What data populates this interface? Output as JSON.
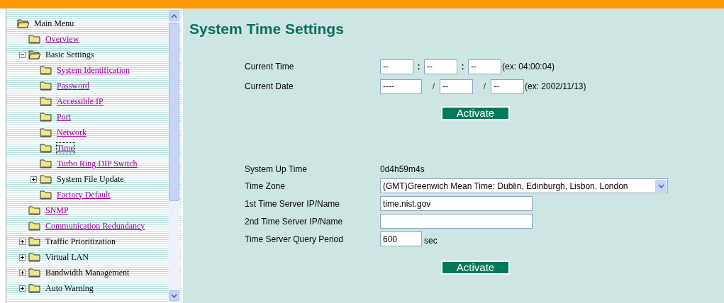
{
  "menu": {
    "label": "Main Menu",
    "kind": "root",
    "selected": false,
    "expanded": true,
    "children": [
      {
        "label": "Overview",
        "kind": "link",
        "selected": false
      },
      {
        "label": "Basic Settings",
        "kind": "group",
        "selected": false,
        "expanded": true,
        "children": [
          {
            "label": "System Identification",
            "kind": "link",
            "selected": false
          },
          {
            "label": "Password",
            "kind": "link",
            "selected": false
          },
          {
            "label": "Accessible IP",
            "kind": "link",
            "selected": false
          },
          {
            "label": "Port",
            "kind": "link",
            "selected": false
          },
          {
            "label": "Network",
            "kind": "link",
            "selected": false
          },
          {
            "label": "Time",
            "kind": "link",
            "selected": true
          },
          {
            "label": "Turbo Ring DIP Switch",
            "kind": "link",
            "selected": false
          },
          {
            "label": "System File Update",
            "kind": "group",
            "selected": false,
            "expanded": false
          },
          {
            "label": "Factory Default",
            "kind": "link",
            "selected": false
          }
        ]
      },
      {
        "label": "SNMP",
        "kind": "link",
        "selected": false
      },
      {
        "label": "Communication Redundancy",
        "kind": "link",
        "selected": false
      },
      {
        "label": "Traffic Prioritization",
        "kind": "group",
        "selected": false,
        "expanded": false
      },
      {
        "label": "Virtual LAN",
        "kind": "group",
        "selected": false,
        "expanded": false
      },
      {
        "label": "Bandwidth Management",
        "kind": "group",
        "selected": false,
        "expanded": false
      },
      {
        "label": "Auto Warning",
        "kind": "group",
        "selected": false,
        "expanded": false
      }
    ]
  },
  "title": "System Time Settings",
  "time_form": {
    "rows": [
      {
        "label": "Current Time",
        "parts": [
          {
            "kind": "input",
            "value": "--"
          },
          {
            "kind": "sep",
            "text": ":"
          },
          {
            "kind": "input",
            "value": "--"
          },
          {
            "kind": "sep",
            "text": ":"
          },
          {
            "kind": "input",
            "value": "--"
          },
          {
            "kind": "hint",
            "text": "(ex: 04:00:04)"
          }
        ]
      },
      {
        "label": "Current Date",
        "parts": [
          {
            "kind": "input",
            "value": "----"
          },
          {
            "kind": "slash",
            "text": "/"
          },
          {
            "kind": "input",
            "value": "--"
          },
          {
            "kind": "slash",
            "text": "/"
          },
          {
            "kind": "input",
            "value": "--"
          },
          {
            "kind": "hint",
            "text": "(ex: 2002/11/13)"
          }
        ]
      }
    ],
    "button": "Activate"
  },
  "server_form": {
    "rows": [
      {
        "label": "System Up Time",
        "kind": "text",
        "value": "0d4h59m4s"
      },
      {
        "label": "Time Zone",
        "kind": "select",
        "value": "(GMT)Greenwich Mean Time: Dublin, Edinburgh, Lisbon, London"
      },
      {
        "label": "1st Time Server IP/Name",
        "kind": "input",
        "value": "time.nist.gov"
      },
      {
        "label": "2nd Time Server IP/Name",
        "kind": "input"
      },
      {
        "label": "Time Server Query Period",
        "kind": "short-input",
        "value": "600",
        "unit": "sec"
      }
    ],
    "button": "Activate"
  }
}
